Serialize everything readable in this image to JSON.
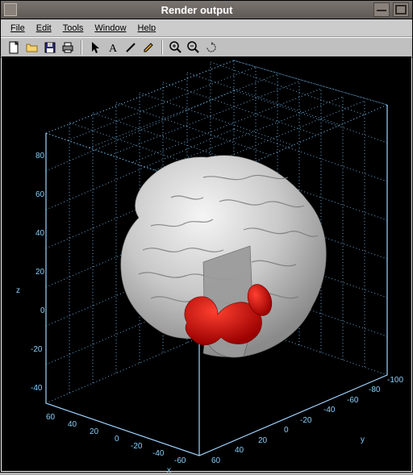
{
  "window": {
    "title": "Render output"
  },
  "menu": {
    "file": "File",
    "edit": "Edit",
    "tools": "Tools",
    "window": "Window",
    "help": "Help"
  },
  "toolbar_icons": [
    "new-file-icon",
    "open-file-icon",
    "save-file-icon",
    "print-icon",
    "pointer-icon",
    "text-annotation-icon",
    "line-icon",
    "pencil-icon",
    "zoom-in-icon",
    "zoom-out-icon",
    "rotate-icon"
  ],
  "chart_data": {
    "type": "3d-render",
    "title": "Render output",
    "axes": {
      "x": {
        "label": "x",
        "ticks": [
          60,
          40,
          20,
          0,
          -20,
          -40,
          -60
        ]
      },
      "y": {
        "label": "y",
        "ticks": [
          60,
          40,
          20,
          0,
          -20,
          -40,
          -60,
          -80,
          -100
        ]
      },
      "z": {
        "label": "z",
        "ticks": [
          80,
          60,
          40,
          20,
          0,
          -20,
          -40
        ]
      }
    },
    "box": {
      "x": [
        -70,
        70
      ],
      "y": [
        -110,
        70
      ],
      "z": [
        -50,
        90
      ]
    },
    "objects": [
      {
        "name": "brain-surface",
        "color": "#d2d2d2",
        "description": "cortical surface, partial cutaway"
      },
      {
        "name": "segmentation",
        "color": "#e00000",
        "description": "red subcortical structure visible through cutaway"
      }
    ],
    "grid_color": "#87cefa",
    "background": "#000000"
  }
}
